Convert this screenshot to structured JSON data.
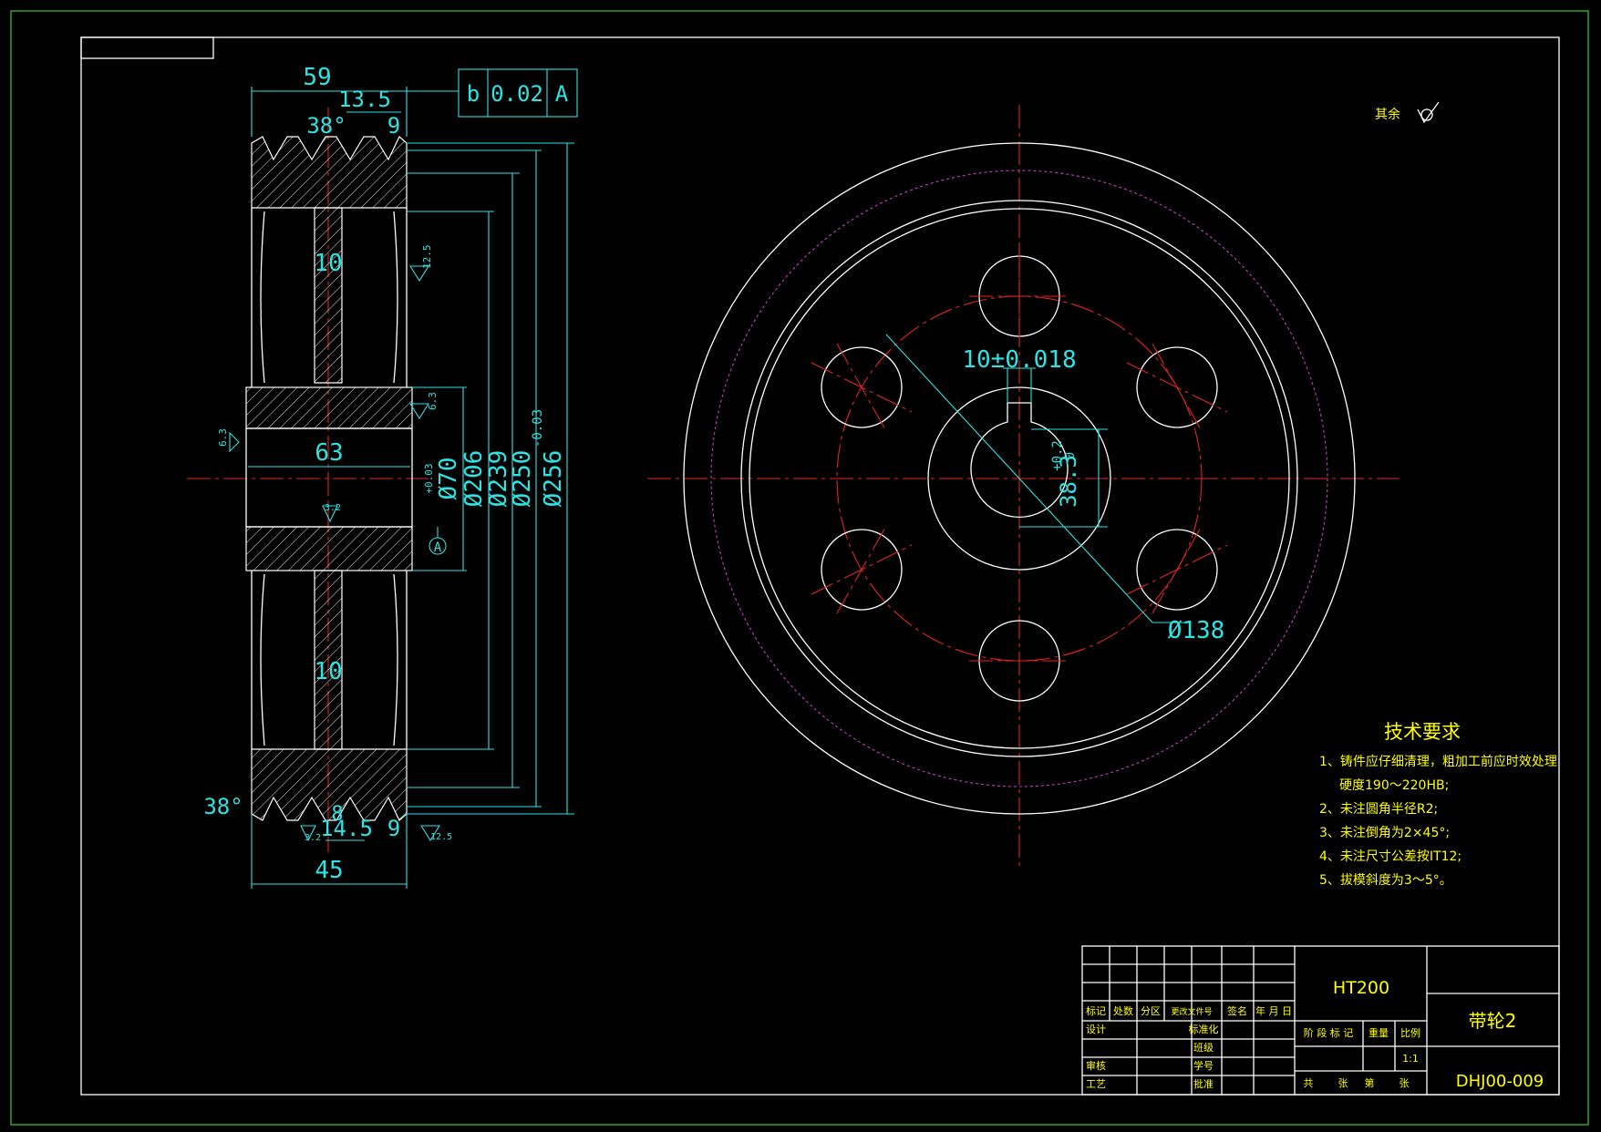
{
  "left_view": {
    "dims": {
      "d59": "59",
      "d13_5": "13.5",
      "d38deg": "38°",
      "d9_top": "9",
      "d10_upper": "10",
      "d10_lower": "10",
      "d63": "63",
      "d70": "Ø70",
      "d70_tol": "+0.03",
      "d206": "Ø206",
      "d239": "Ø239",
      "d250": "Ø250",
      "d250_tol": "-0.03",
      "d256": "Ø256",
      "d45": "45",
      "d14_5": "14.5",
      "d9_bottom": "9",
      "d38deg_bottom": "38°",
      "d8": "8",
      "rough_12_5_a": "12.5",
      "rough_12_5_b": "12.5",
      "rough_6_3_a": "6.3",
      "rough_6_3_b": "6.3",
      "rough_3_2_a": "3.2",
      "rough_3_2_b": "3.2",
      "datum_A": "A"
    },
    "tolerance_frame": {
      "symbol": "b",
      "value": "0.02",
      "datum": "A"
    }
  },
  "right_view": {
    "keyway_dim": "10±0.018",
    "hub_dim": "38.3",
    "hub_tol_upper": "+0.2",
    "hub_tol_lower": "0",
    "bolt_circle_dim": "Ø138",
    "rest_roughness_label": "其余"
  },
  "tech_requirements": {
    "title": "技术要求",
    "items": [
      "1、铸件应仔细清理，粗加工前应时效处理",
      "硬度190～220HB;",
      "2、未注圆角半径R2;",
      "3、未注倒角为2×45°;",
      "4、未注尺寸公差按IT12;",
      "5、拔模斜度为3～5°。"
    ]
  },
  "title_block": {
    "material": "HT200",
    "part_name": "带轮2",
    "drawing_no": "DHJ00-009",
    "scale": "1:1",
    "labels": {
      "mark": "标记",
      "count": "处数",
      "zone": "分区",
      "change_doc": "更改文件号",
      "sign": "签名",
      "date": "年 月 日",
      "design": "设计",
      "standardize": "标准化",
      "class": "班级",
      "student_no": "学号",
      "review": "审核",
      "process": "工艺",
      "approve": "批准",
      "stage_mark": "阶 段 标 记",
      "weight": "重量",
      "scale_label": "比例",
      "total": "共",
      "sheets": "张",
      "sheet_no": "第",
      "sheets2": "张"
    }
  },
  "colors": {
    "outline": "#ffffff",
    "dimension": "#2de3e3",
    "centerline": "#e02424",
    "pitch": "#c040c0",
    "border": "#3cc83c"
  }
}
